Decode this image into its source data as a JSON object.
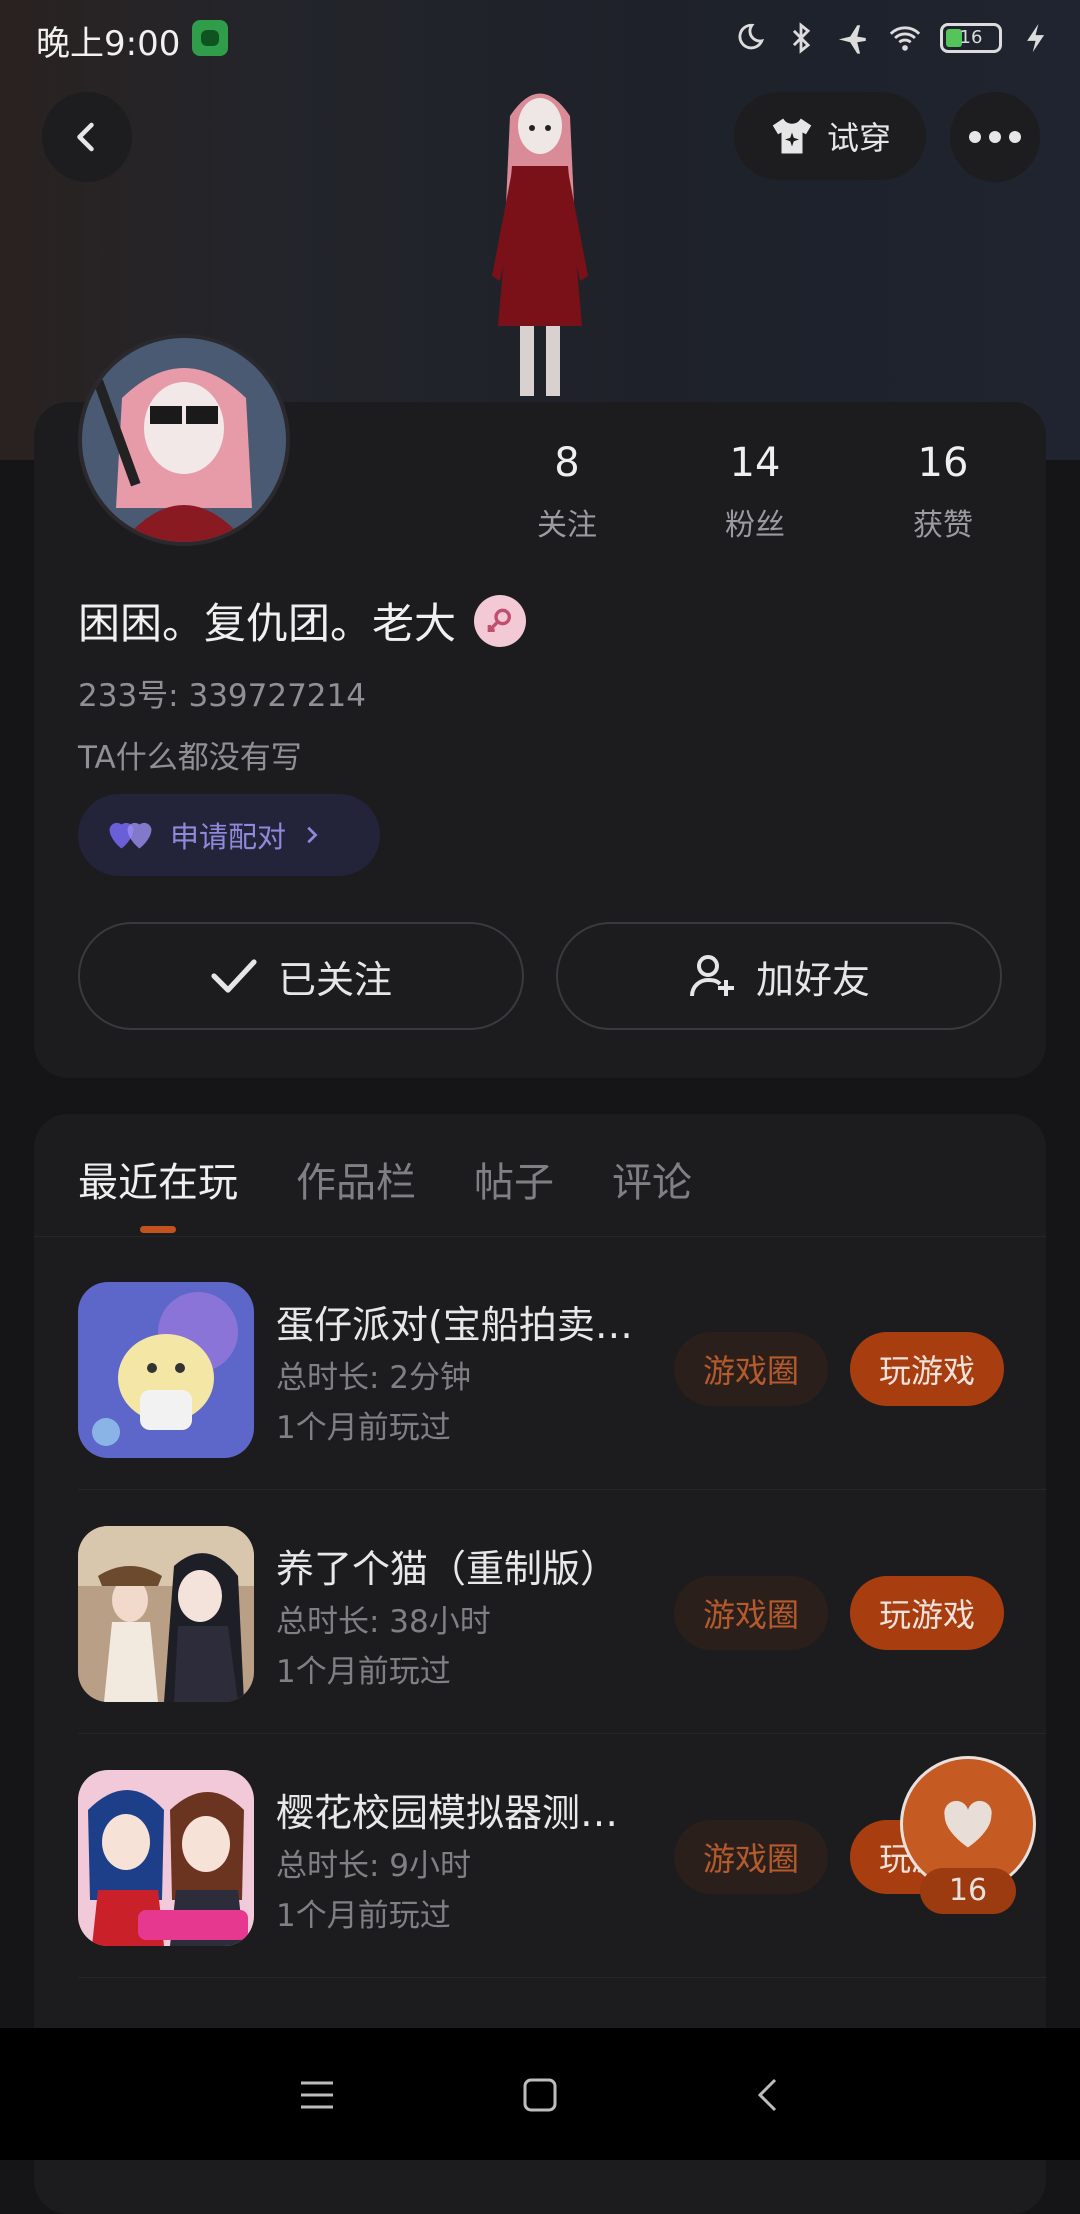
{
  "status_bar": {
    "time": "晚上9:00",
    "battery": "16"
  },
  "header": {
    "tryon_label": "试穿"
  },
  "profile": {
    "stats": [
      {
        "value": "8",
        "label": "关注"
      },
      {
        "value": "14",
        "label": "粉丝"
      },
      {
        "value": "16",
        "label": "获赞"
      }
    ],
    "nickname": "困困。复仇团。老大",
    "uid": "233号: 339727214",
    "bio": "TA什么都没有写",
    "pair_label": "申请配对",
    "followed_label": "已关注",
    "add_friend_label": "加好友",
    "gender": "female"
  },
  "tabs": [
    {
      "label": "最近在玩",
      "active": true
    },
    {
      "label": "作品栏",
      "active": false
    },
    {
      "label": "帖子",
      "active": false
    },
    {
      "label": "评论",
      "active": false
    }
  ],
  "games": [
    {
      "title": "蛋仔派对(宝船拍卖…",
      "duration": "总时长: 2分钟",
      "last_played": "1个月前玩过",
      "circle_label": "游戏圈",
      "play_label": "玩游戏"
    },
    {
      "title": "养了个猫（重制版）",
      "duration": "总时长: 38小时",
      "last_played": "1个月前玩过",
      "circle_label": "游戏圈",
      "play_label": "玩游戏"
    },
    {
      "title": "樱花校园模拟器测…",
      "duration": "总时长: 9小时",
      "last_played": "1个月前玩过",
      "circle_label": "游戏圈",
      "play_label": "玩游戏"
    }
  ],
  "like_count": "16",
  "colors": {
    "accent": "#a83e10",
    "accent_text": "#b45a2c",
    "pair_purple": "#8e89d9",
    "female_pink": "#f3c9d6"
  }
}
